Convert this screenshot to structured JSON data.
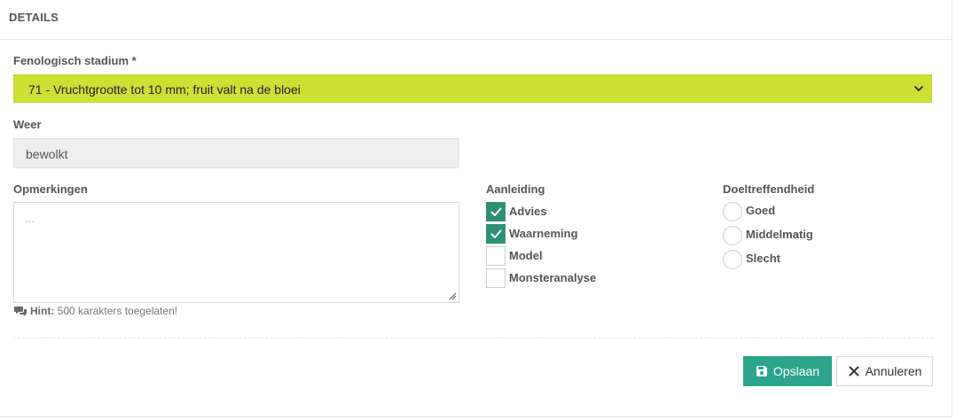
{
  "panel": {
    "title": "DETAILS"
  },
  "stage": {
    "label": "Fenologisch stadium *",
    "selected": "71 - Vruchtgrootte tot 10 mm; fruit valt na de bloei",
    "accent_color": "#cfdf34"
  },
  "weather": {
    "label": "Weer",
    "value": "bewolkt"
  },
  "remarks": {
    "label": "Opmerkingen",
    "placeholder": "...",
    "hint_prefix": "Hint:",
    "hint_text": "500 karakters toegelaten!"
  },
  "reason": {
    "label": "Aanleiding",
    "options": [
      {
        "label": "Advies",
        "checked": true
      },
      {
        "label": "Waarneming",
        "checked": true
      },
      {
        "label": "Model",
        "checked": false
      },
      {
        "label": "Monsteranalyse",
        "checked": false
      }
    ],
    "check_color": "#2f8f74"
  },
  "effectiveness": {
    "label": "Doeltreffendheid",
    "options": [
      {
        "label": "Goed",
        "selected": false
      },
      {
        "label": "Middelmatig",
        "selected": false
      },
      {
        "label": "Slecht",
        "selected": false
      }
    ]
  },
  "actions": {
    "save_label": "Opslaan",
    "cancel_label": "Annuleren",
    "save_color": "#2ca58a"
  }
}
